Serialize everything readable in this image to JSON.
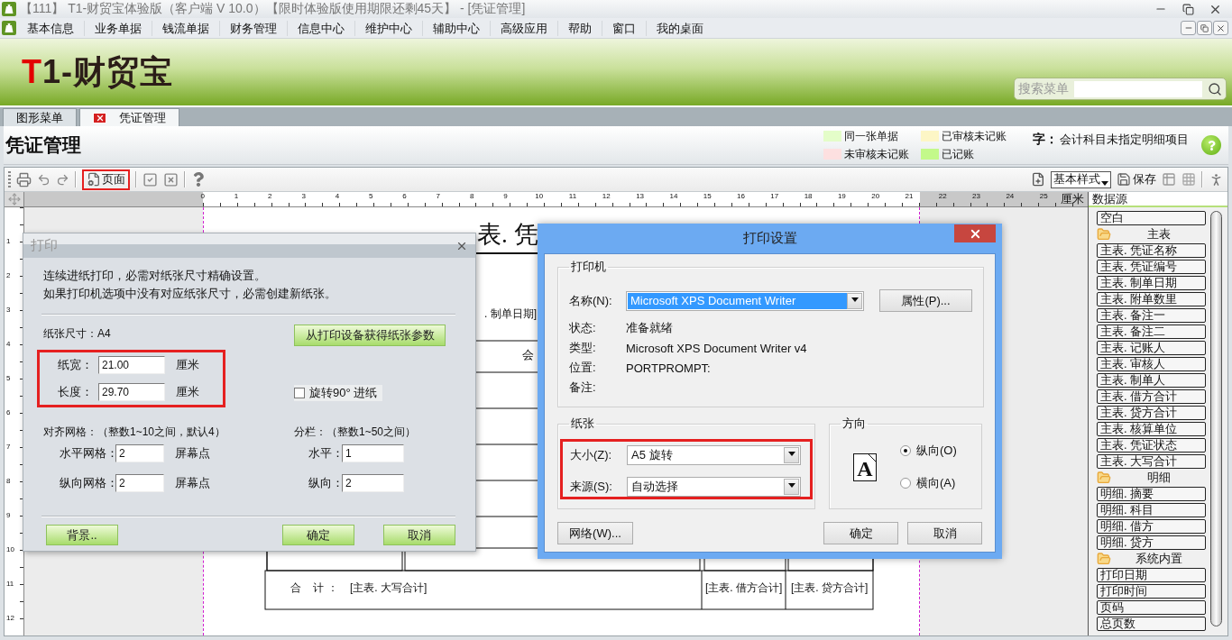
{
  "window": {
    "title": "【111】 T1-财贸宝体验版（客户端 V 10.0）【限时体验版使用期限还剩45天】 - [凭证管理]"
  },
  "menu": [
    "基本信息",
    "业务单据",
    "钱流单据",
    "财务管理",
    "信息中心",
    "维护中心",
    "辅助中心",
    "高级应用",
    "帮助",
    "窗口",
    "我的桌面"
  ],
  "banner": {
    "logo_accent": "T",
    "logo_text": "1-财贸宝",
    "search_label": "搜索菜单"
  },
  "tabs": [
    {
      "label": "图形菜单",
      "selected": false
    },
    {
      "label": "凭证管理",
      "selected": true
    }
  ],
  "page_title": "凭证管理",
  "legend": [
    {
      "label": "同一张单据",
      "color": "#e4fdc9"
    },
    {
      "label": "已审核未记账",
      "color": "#fdf6c6"
    },
    {
      "label": "未审核未记账",
      "color": "#fde0e0"
    },
    {
      "label": "已记账",
      "color": "#c3f98a"
    }
  ],
  "legend_note": {
    "mark": "字：",
    "text": "会计科目未指定明细项目"
  },
  "toolbar": {
    "page_button": {
      "label": "页面",
      "highlighted": true
    },
    "style_select": "基本样式",
    "save_label": "保存"
  },
  "ruler": {
    "unit": "厘米",
    "h_marks": [
      "0",
      "1",
      "2",
      "3",
      "4",
      "5",
      "6",
      "7",
      "8",
      "9",
      "10",
      "11",
      "12",
      "13",
      "14",
      "15",
      "16",
      "17",
      "18",
      "19",
      "20",
      "21",
      "22",
      "23",
      "24",
      "25"
    ],
    "v_marks": [
      "1",
      "2",
      "3",
      "4",
      "5",
      "6",
      "7",
      "8",
      "9",
      "10",
      "11",
      "12"
    ]
  },
  "document": {
    "title_fragment": "表. 凭",
    "date_field": ". 制单日期]",
    "column_fragment": "会",
    "total_label": "合    计 ：",
    "total_fields": [
      "[主表. 大写合计]",
      "[主表. 借方合计]",
      "[主表. 贷方合计]"
    ]
  },
  "data_source": {
    "title": "数据源",
    "items": [
      {
        "kind": "field",
        "label": "空白"
      },
      {
        "kind": "folder",
        "label": "主表"
      },
      {
        "kind": "field",
        "label": "主表. 凭证名称"
      },
      {
        "kind": "field",
        "label": "主表. 凭证编号"
      },
      {
        "kind": "field",
        "label": "主表. 制单日期"
      },
      {
        "kind": "field",
        "label": "主表. 附单数里"
      },
      {
        "kind": "field",
        "label": "主表. 备注一"
      },
      {
        "kind": "field",
        "label": "主表. 备注二"
      },
      {
        "kind": "field",
        "label": "主表. 记账人"
      },
      {
        "kind": "field",
        "label": "主表. 审核人"
      },
      {
        "kind": "field",
        "label": "主表. 制单人"
      },
      {
        "kind": "field",
        "label": "主表. 借方合计"
      },
      {
        "kind": "field",
        "label": "主表. 贷方合计"
      },
      {
        "kind": "field",
        "label": "主表. 核算单位"
      },
      {
        "kind": "field",
        "label": "主表. 凭证状态"
      },
      {
        "kind": "field",
        "label": "主表. 大写合计"
      },
      {
        "kind": "folder",
        "label": "明细"
      },
      {
        "kind": "field",
        "label": "明细. 摘要"
      },
      {
        "kind": "field",
        "label": "明细. 科目"
      },
      {
        "kind": "field",
        "label": "明细. 借方"
      },
      {
        "kind": "field",
        "label": "明细. 贷方"
      },
      {
        "kind": "folder",
        "label": "系统内置"
      },
      {
        "kind": "field",
        "label": "打印日期"
      },
      {
        "kind": "field",
        "label": "打印时间"
      },
      {
        "kind": "field",
        "label": "页码"
      },
      {
        "kind": "field",
        "label": "总页数"
      }
    ]
  },
  "print_dialog": {
    "title": "打印",
    "notes": [
      "连续进纸打印，必需对纸张尺寸精确设置。",
      "如果打印机选项中没有对应纸张尺寸，必需创建新纸张。"
    ],
    "paper_size": "纸张尺寸：A4",
    "fetch_button": "从打印设备获得纸张参数",
    "size_group": {
      "highlighted": true,
      "fields": [
        {
          "label": "纸宽：",
          "value": "21.00",
          "unit": "厘米"
        },
        {
          "label": "长度：",
          "value": "29.70",
          "unit": "厘米"
        }
      ]
    },
    "rotate": {
      "label": "旋转90° 进纸",
      "checked": false
    },
    "grid": {
      "heading": "对齐网格：（整数1~10之间，默认4）",
      "fields": [
        {
          "label": "水平网格：",
          "value": "2",
          "unit": "屏幕点"
        },
        {
          "label": "纵向网格：",
          "value": "2",
          "unit": "屏幕点"
        }
      ]
    },
    "columns": {
      "heading": "分栏：（整数1~50之间）",
      "fields": [
        {
          "label": "水平：",
          "value": "1"
        },
        {
          "label": "纵向：",
          "value": "2"
        }
      ]
    },
    "buttons": [
      "背景..",
      "确定",
      "取消"
    ]
  },
  "print_setup": {
    "title": "打印设置",
    "printer": {
      "legend": "打印机",
      "name": {
        "label": "名称(N):",
        "value": "Microsoft XPS Document Writer",
        "focused": true
      },
      "properties_button": "属性(P)...",
      "info": [
        {
          "label": "状态:",
          "value": "准备就绪"
        },
        {
          "label": "类型:",
          "value": "Microsoft XPS Document Writer v4"
        },
        {
          "label": "位置:",
          "value": "PORTPROMPT:"
        },
        {
          "label": "备注:"
        }
      ]
    },
    "paper": {
      "legend": "纸张",
      "highlighted": true,
      "fields": [
        {
          "label": "大小(Z):",
          "value": "A5 旋转"
        },
        {
          "label": "来源(S):",
          "value": "自动选择"
        }
      ]
    },
    "orientation": {
      "legend": "方向",
      "preview_glyph": "A",
      "options": [
        {
          "label": "纵向(O)",
          "selected": true
        },
        {
          "label": "横向(A)",
          "selected": false
        }
      ]
    },
    "buttons": [
      "网络(W)...",
      "确定",
      "取消"
    ]
  }
}
